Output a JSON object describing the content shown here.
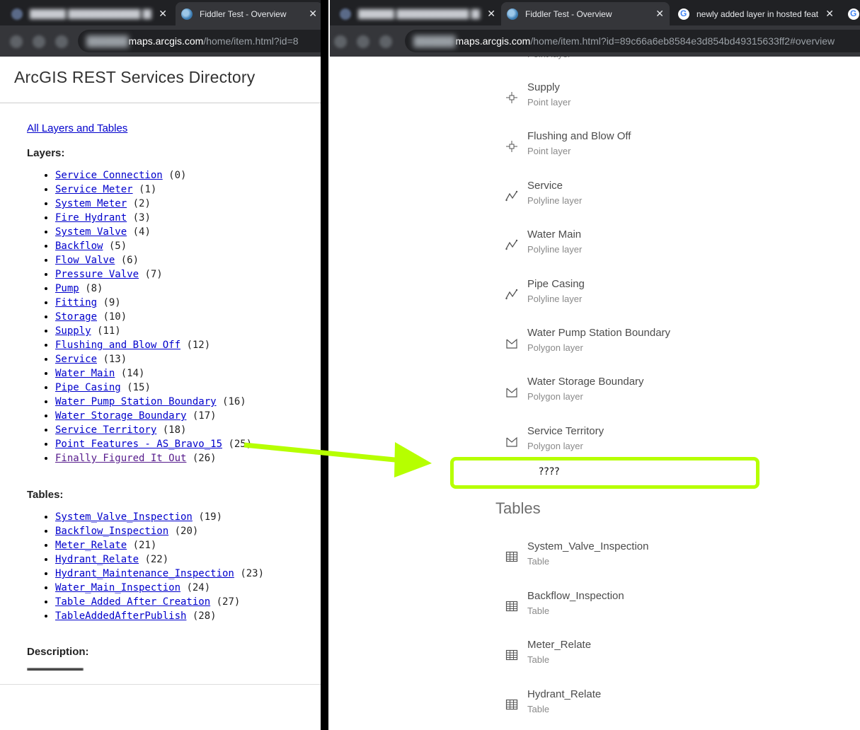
{
  "left_window": {
    "tabs": [
      {
        "title": "",
        "favicon": "blurred-favicon",
        "close": "✕"
      },
      {
        "title": "Fiddler Test - Overview",
        "favicon": "arcgis-globe-icon",
        "close": "✕"
      }
    ],
    "address": {
      "domain": "maps.arcgis.com",
      "path": "/home/item.html?id=8"
    }
  },
  "right_window": {
    "tabs": [
      {
        "title": "",
        "favicon": "blurred-favicon",
        "close": "✕"
      },
      {
        "title": "Fiddler Test - Overview",
        "favicon": "arcgis-globe-icon",
        "close": "✕"
      },
      {
        "title": "newly added layer in hosted feat",
        "favicon": "google-icon",
        "close": "✕"
      }
    ],
    "address": {
      "domain": "maps.arcgis.com",
      "path": "/home/item.html?id=89c66a6eb8584e3d854bd49315633ff2#overview"
    }
  },
  "rest_directory": {
    "title": "ArcGIS REST Services Directory",
    "all_link": "All Layers and Tables",
    "layers_heading": "Layers:",
    "layers": [
      {
        "name": "Service Connection",
        "id": "(0)"
      },
      {
        "name": "Service Meter",
        "id": "(1)"
      },
      {
        "name": "System Meter",
        "id": "(2)"
      },
      {
        "name": "Fire Hydrant",
        "id": "(3)"
      },
      {
        "name": "System Valve",
        "id": "(4)"
      },
      {
        "name": "Backflow",
        "id": "(5)"
      },
      {
        "name": "Flow Valve",
        "id": "(6)"
      },
      {
        "name": "Pressure Valve",
        "id": "(7)"
      },
      {
        "name": "Pump",
        "id": "(8)"
      },
      {
        "name": "Fitting",
        "id": "(9)"
      },
      {
        "name": "Storage",
        "id": "(10)"
      },
      {
        "name": "Supply",
        "id": "(11)"
      },
      {
        "name": "Flushing and Blow Off",
        "id": "(12)"
      },
      {
        "name": "Service",
        "id": "(13)"
      },
      {
        "name": "Water Main",
        "id": "(14)"
      },
      {
        "name": "Pipe Casing",
        "id": "(15)"
      },
      {
        "name": "Water Pump Station Boundary",
        "id": "(16)"
      },
      {
        "name": "Water Storage Boundary",
        "id": "(17)"
      },
      {
        "name": "Service Territory",
        "id": "(18)"
      },
      {
        "name": "Point Features - AS_Bravo_15",
        "id": "(25)"
      },
      {
        "name": "Finally Figured It Out",
        "id": "(26)"
      }
    ],
    "tables_heading": "Tables:",
    "tables": [
      {
        "name": "System_Valve_Inspection",
        "id": "(19)"
      },
      {
        "name": "Backflow_Inspection",
        "id": "(20)"
      },
      {
        "name": "Meter_Relate",
        "id": "(21)"
      },
      {
        "name": "Hydrant_Relate",
        "id": "(22)"
      },
      {
        "name": "Hydrant_Maintenance_Inspection",
        "id": "(23)"
      },
      {
        "name": "Water_Main_Inspection",
        "id": "(24)"
      },
      {
        "name": "Table Added After Creation",
        "id": "(27)"
      },
      {
        "name": "TableAddedAfterPublish",
        "id": "(28)"
      }
    ],
    "description_heading": "Description:"
  },
  "item_overview": {
    "partial_top_type": "Point layer",
    "layers": [
      {
        "name": "Supply",
        "type": "Point layer",
        "icon": "point-icon"
      },
      {
        "name": "Flushing and Blow Off",
        "type": "Point layer",
        "icon": "point-icon"
      },
      {
        "name": "Service",
        "type": "Polyline layer",
        "icon": "polyline-icon"
      },
      {
        "name": "Water Main",
        "type": "Polyline layer",
        "icon": "polyline-icon"
      },
      {
        "name": "Pipe Casing",
        "type": "Polyline layer",
        "icon": "polyline-icon"
      },
      {
        "name": "Water Pump Station Boundary",
        "type": "Polygon layer",
        "icon": "polygon-icon"
      },
      {
        "name": "Water Storage Boundary",
        "type": "Polygon layer",
        "icon": "polygon-icon"
      },
      {
        "name": "Service Territory",
        "type": "Polygon layer",
        "icon": "polygon-icon"
      }
    ],
    "missing_placeholder": "????",
    "tables_heading": "Tables",
    "tables": [
      {
        "name": "System_Valve_Inspection",
        "type": "Table",
        "icon": "table-icon"
      },
      {
        "name": "Backflow_Inspection",
        "type": "Table",
        "icon": "table-icon"
      },
      {
        "name": "Meter_Relate",
        "type": "Table",
        "icon": "table-icon"
      },
      {
        "name": "Hydrant_Relate",
        "type": "Table",
        "icon": "table-icon"
      }
    ]
  },
  "annotation": {
    "highlight_color": "#b6ff00",
    "divider_color": "#000000"
  }
}
